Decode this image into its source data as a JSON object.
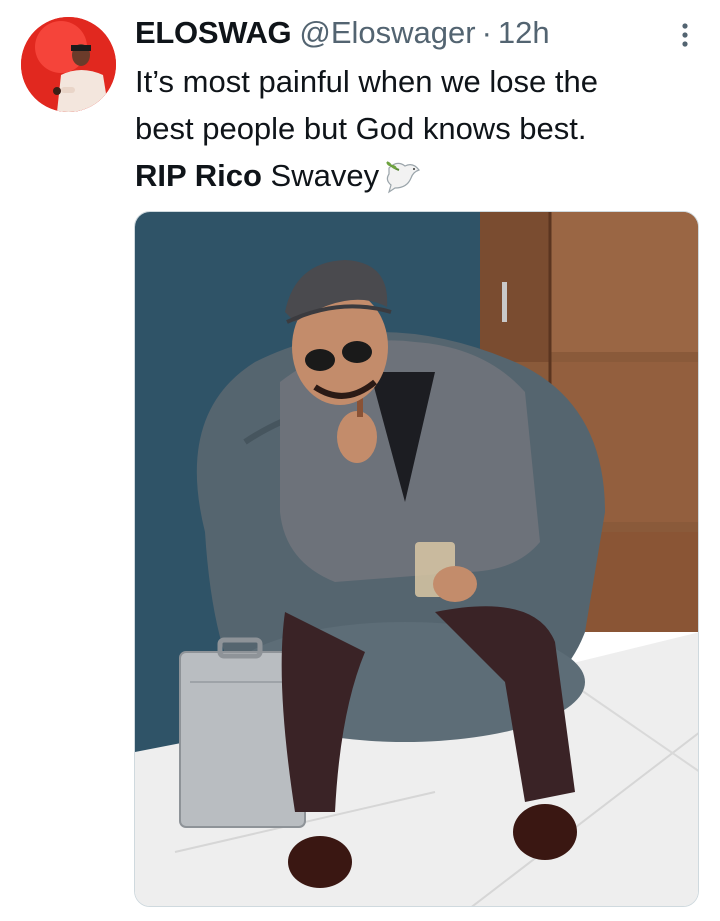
{
  "tweet": {
    "display_name": "ELOSWAG",
    "handle": "@Eloswager",
    "separator": "·",
    "time": "12h",
    "text_lines": [
      "It’s most painful when we lose the",
      "best people but God knows best."
    ],
    "rip_bold": "RIP Rico",
    "rip_rest": " Swavey",
    "emoji": "dove-with-olive-branch-icon"
  },
  "icons": {
    "more": "more-vertical-icon",
    "avatar": "avatar"
  },
  "colors": {
    "text": "#0f1419",
    "secondary": "#536471",
    "avatar_bg": "#e1281f",
    "wall": "#2f5367",
    "wood": "#8a5a3a",
    "chair": "#55656f",
    "floor": "#eeeeee"
  }
}
